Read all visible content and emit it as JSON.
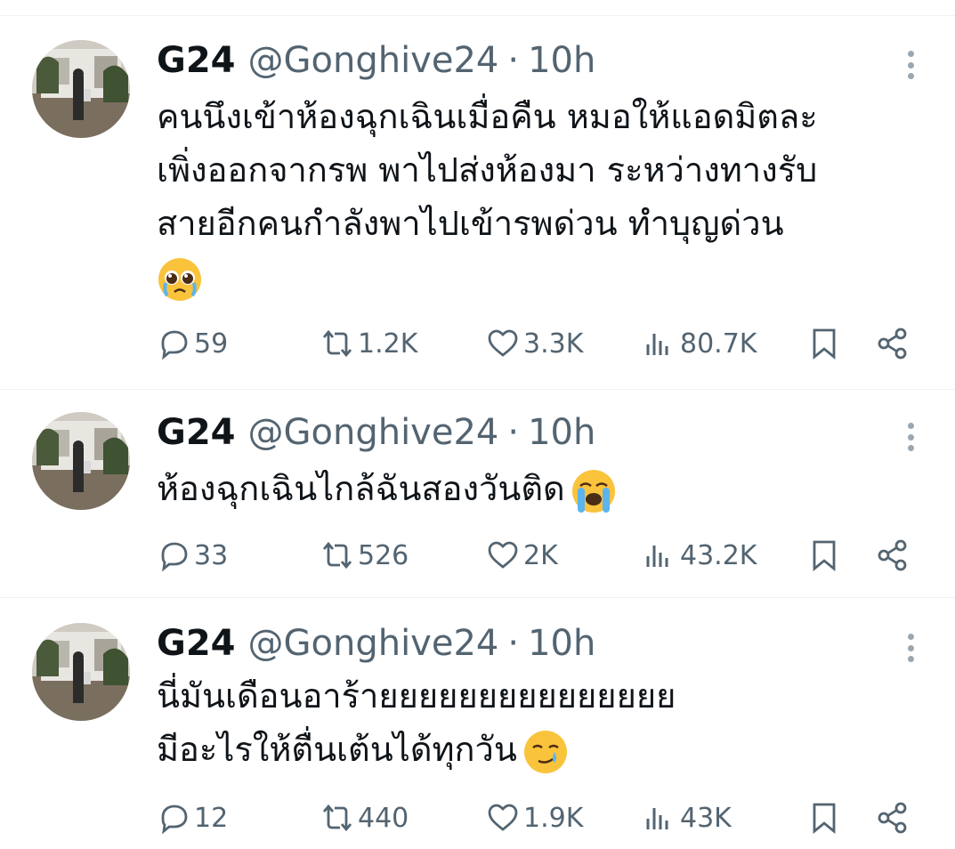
{
  "tweets": [
    {
      "name": "G24",
      "handle": "@Gonghive24",
      "separator": "·",
      "time": "10h",
      "lines": [
        "คนนึงเข้าห้องฉุกเฉินเมื่อคืน หมอให้แอดมิตละ",
        "เพิ่งออกจากรพ พาไปส่งห้องมา ระหว่างทางรับ",
        "สายอีกคนกำลังพาไปเข้ารพด่วน ทำบุญด่วน",
        ""
      ],
      "emoji": "pleading-face-with-tears",
      "replies": "59",
      "retweets": "1.2K",
      "likes": "3.3K",
      "views": "80.7K"
    },
    {
      "name": "G24",
      "handle": "@Gonghive24",
      "separator": "·",
      "time": "10h",
      "lines": [
        "ห้องฉุกเฉินไกล้ฉันสองวันติด"
      ],
      "emoji": "loudly-crying-face",
      "replies": "33",
      "retweets": "526",
      "likes": "2K",
      "views": "43.2K"
    },
    {
      "name": "G24",
      "handle": "@Gonghive24",
      "separator": "·",
      "time": "10h",
      "lines": [
        "นี่มันเดือนอาร้ายยยยยยยยยยยยยยย",
        "มีอะไรให้ตื่นเต้นได้ทุกวัน"
      ],
      "emoji": "smiling-face-with-tear",
      "replies": "12",
      "retweets": "440",
      "likes": "1.9K",
      "views": "43K"
    }
  ],
  "colors": {
    "text": "#0f1419",
    "secondary": "#536471",
    "divider": "#eff3f4"
  }
}
